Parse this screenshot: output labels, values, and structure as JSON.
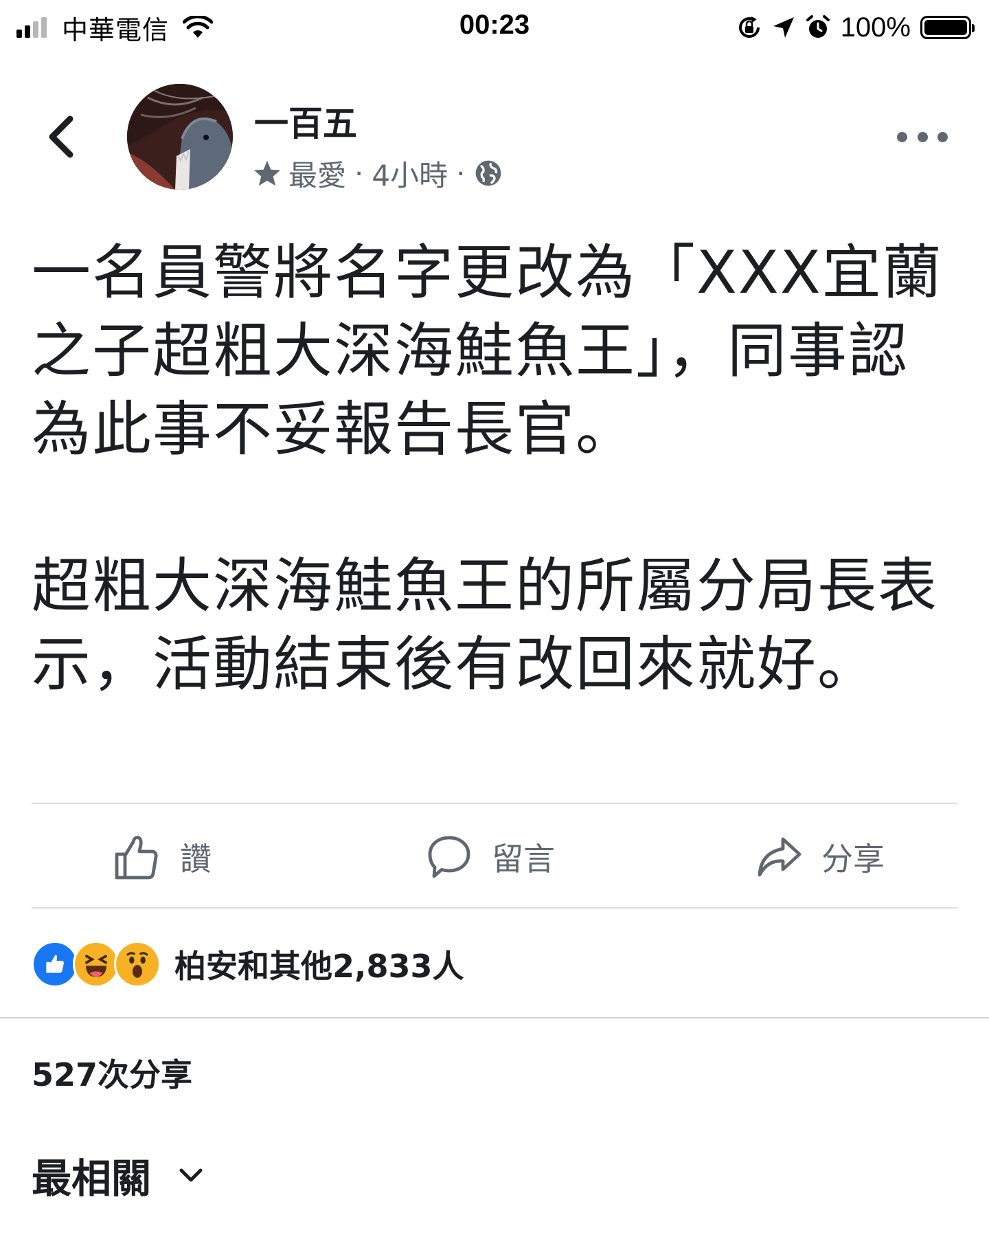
{
  "status_bar": {
    "carrier": "中華電信",
    "time": "00:23",
    "battery_percent": "100%",
    "signal_bars_active": 2,
    "signal_bars_total": 4,
    "icons": [
      "wifi-icon",
      "orientation-lock-icon",
      "location-arrow-icon",
      "alarm-icon",
      "battery-icon"
    ]
  },
  "post": {
    "author": "一百五",
    "meta": {
      "favorite_label": "最愛",
      "time_ago": "4小時",
      "separator": "·",
      "audience_icon": "globe-icon"
    },
    "paragraphs": [
      "一名員警將名字更改為「XXX宜蘭之子超粗大深海鮭魚王」，同事認為此事不妥報告長官。",
      "超粗大深海鮭魚王的所屬分局長表示，活動結束後有改回來就好。"
    ]
  },
  "actions": {
    "like_label": "讚",
    "comment_label": "留言",
    "share_label": "分享"
  },
  "reactions": {
    "types": [
      "like",
      "haha",
      "wow"
    ],
    "summary": "柏安和其他2,833人"
  },
  "shares": {
    "text": "527次分享"
  },
  "comments_sort": {
    "label": "最相關"
  },
  "colors": {
    "text_primary": "#1c1e21",
    "text_secondary": "#606770",
    "divider": "#dadde1",
    "like_blue": "#1877f2",
    "reaction_yellow": "#f7b125"
  }
}
